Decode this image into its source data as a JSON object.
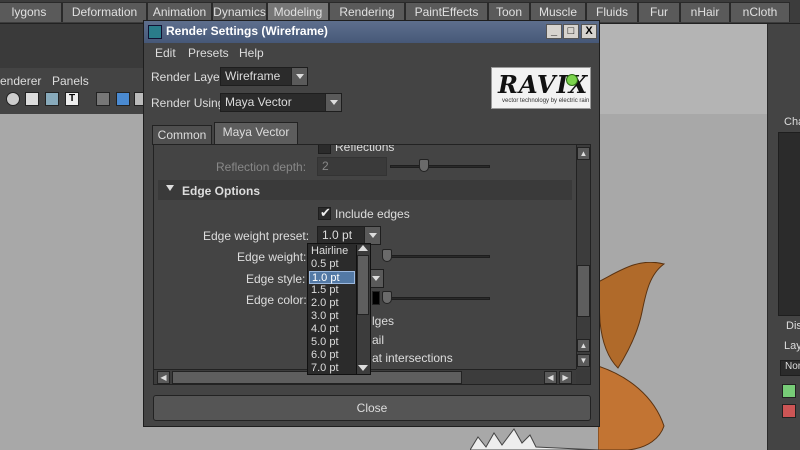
{
  "shelf_tabs": [
    "lygons",
    "Deformation",
    "Animation",
    "Dynamics",
    "Modeling",
    "Rendering",
    "PaintEffects",
    "Toon",
    "Muscle",
    "Fluids",
    "Fur",
    "nHair",
    "nCloth"
  ],
  "shelf_active": "Modeling",
  "viewport_menu": {
    "renderer": "enderer",
    "panels": "Panels"
  },
  "right_panel": {
    "top_letter": "Cha",
    "tab_dis": "Dis",
    "tab_lay": "Lay",
    "dropdown": "Nor"
  },
  "dialog": {
    "title": "Render Settings (Wireframe)",
    "window_buttons": {
      "minimize": "_",
      "maximize": "□",
      "close": "X"
    },
    "menu": {
      "edit": "Edit",
      "presets": "Presets",
      "help": "Help"
    },
    "render_layer_label": "Render Layer",
    "render_layer_value": "Wireframe",
    "render_using_label": "Render Using",
    "render_using_value": "Maya Vector",
    "logo_text": "RAVIX",
    "logo_sub": "vector technology by electric rain",
    "tabs": [
      "Common",
      "Maya Vector"
    ],
    "reflections_label": "Reflections",
    "reflection_depth_label": "Reflection depth:",
    "reflection_depth_value": "2",
    "edge_options_header": "Edge Options",
    "include_edges_label": "Include edges",
    "edge_weight_preset_label": "Edge weight preset:",
    "edge_weight_preset_value": "1.0 pt",
    "edge_weight_label": "Edge weight:",
    "edge_style_label": "Edge style:",
    "edge_color_label": "Edge color:",
    "partial_text_1": "lges",
    "partial_text_2": "ail",
    "partial_text_3": "at intersections",
    "dropdown_options": [
      "Hairline",
      "0.5 pt",
      "1.0 pt",
      "1.5 pt",
      "2.0 pt",
      "3.0 pt",
      "4.0 pt",
      "5.0 pt",
      "6.0 pt",
      "7.0 pt"
    ],
    "dropdown_selected": "1.0 pt",
    "close_label": "Close"
  }
}
